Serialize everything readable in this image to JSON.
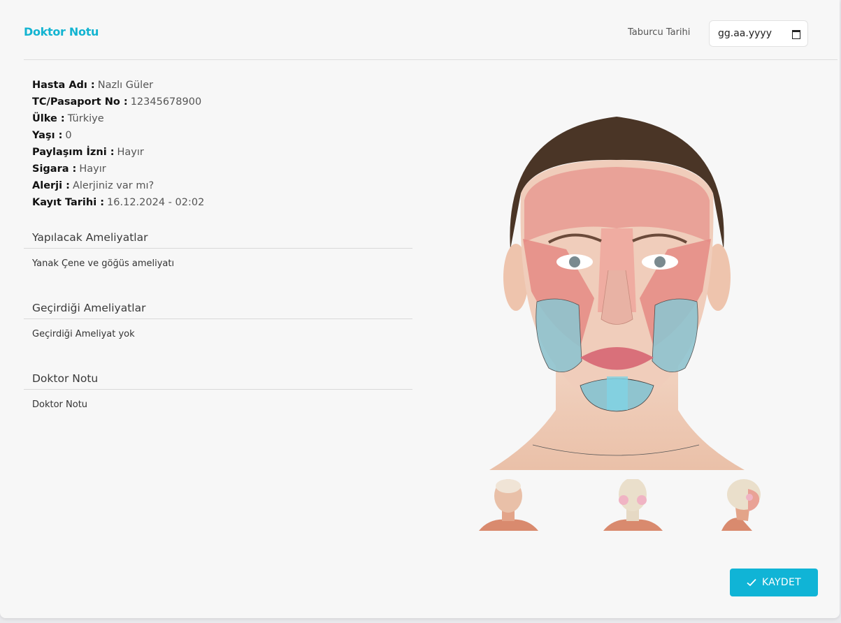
{
  "header": {
    "title": "Doktor Notu",
    "discharge_label": "Taburcu Tarihi",
    "discharge_placeholder": "gg.aa.yyyy"
  },
  "patient": [
    {
      "label": "Hasta Adı :",
      "value": "Nazlı Güler"
    },
    {
      "label": "TC/Pasaport No :",
      "value": "12345678900"
    },
    {
      "label": "Ülke :",
      "value": "Türkiye"
    },
    {
      "label": "Yaşı :",
      "value": "0"
    },
    {
      "label": "Paylaşım İzni :",
      "value": "Hayır"
    },
    {
      "label": "Sigara :",
      "value": "Hayır"
    },
    {
      "label": "Alerji :",
      "value": "Alerjiniz var mı?"
    },
    {
      "label": "Kayıt Tarihi :",
      "value": "16.12.2024 - 02:02"
    }
  ],
  "sections": {
    "planned": {
      "title": "Yapılacak Ameliyatlar",
      "body": "Yanak Çene ve göğüs ameliyatı"
    },
    "past": {
      "title": "Geçirdiği Ameliyatlar",
      "body": "Geçirdiği Ameliyat yok"
    },
    "note": {
      "title": "Doktor Notu",
      "body": "Doktor Notu"
    }
  },
  "actions": {
    "save_label": "KAYDET"
  },
  "colors": {
    "accent": "#10b4d6",
    "title": "#13b4d1"
  }
}
